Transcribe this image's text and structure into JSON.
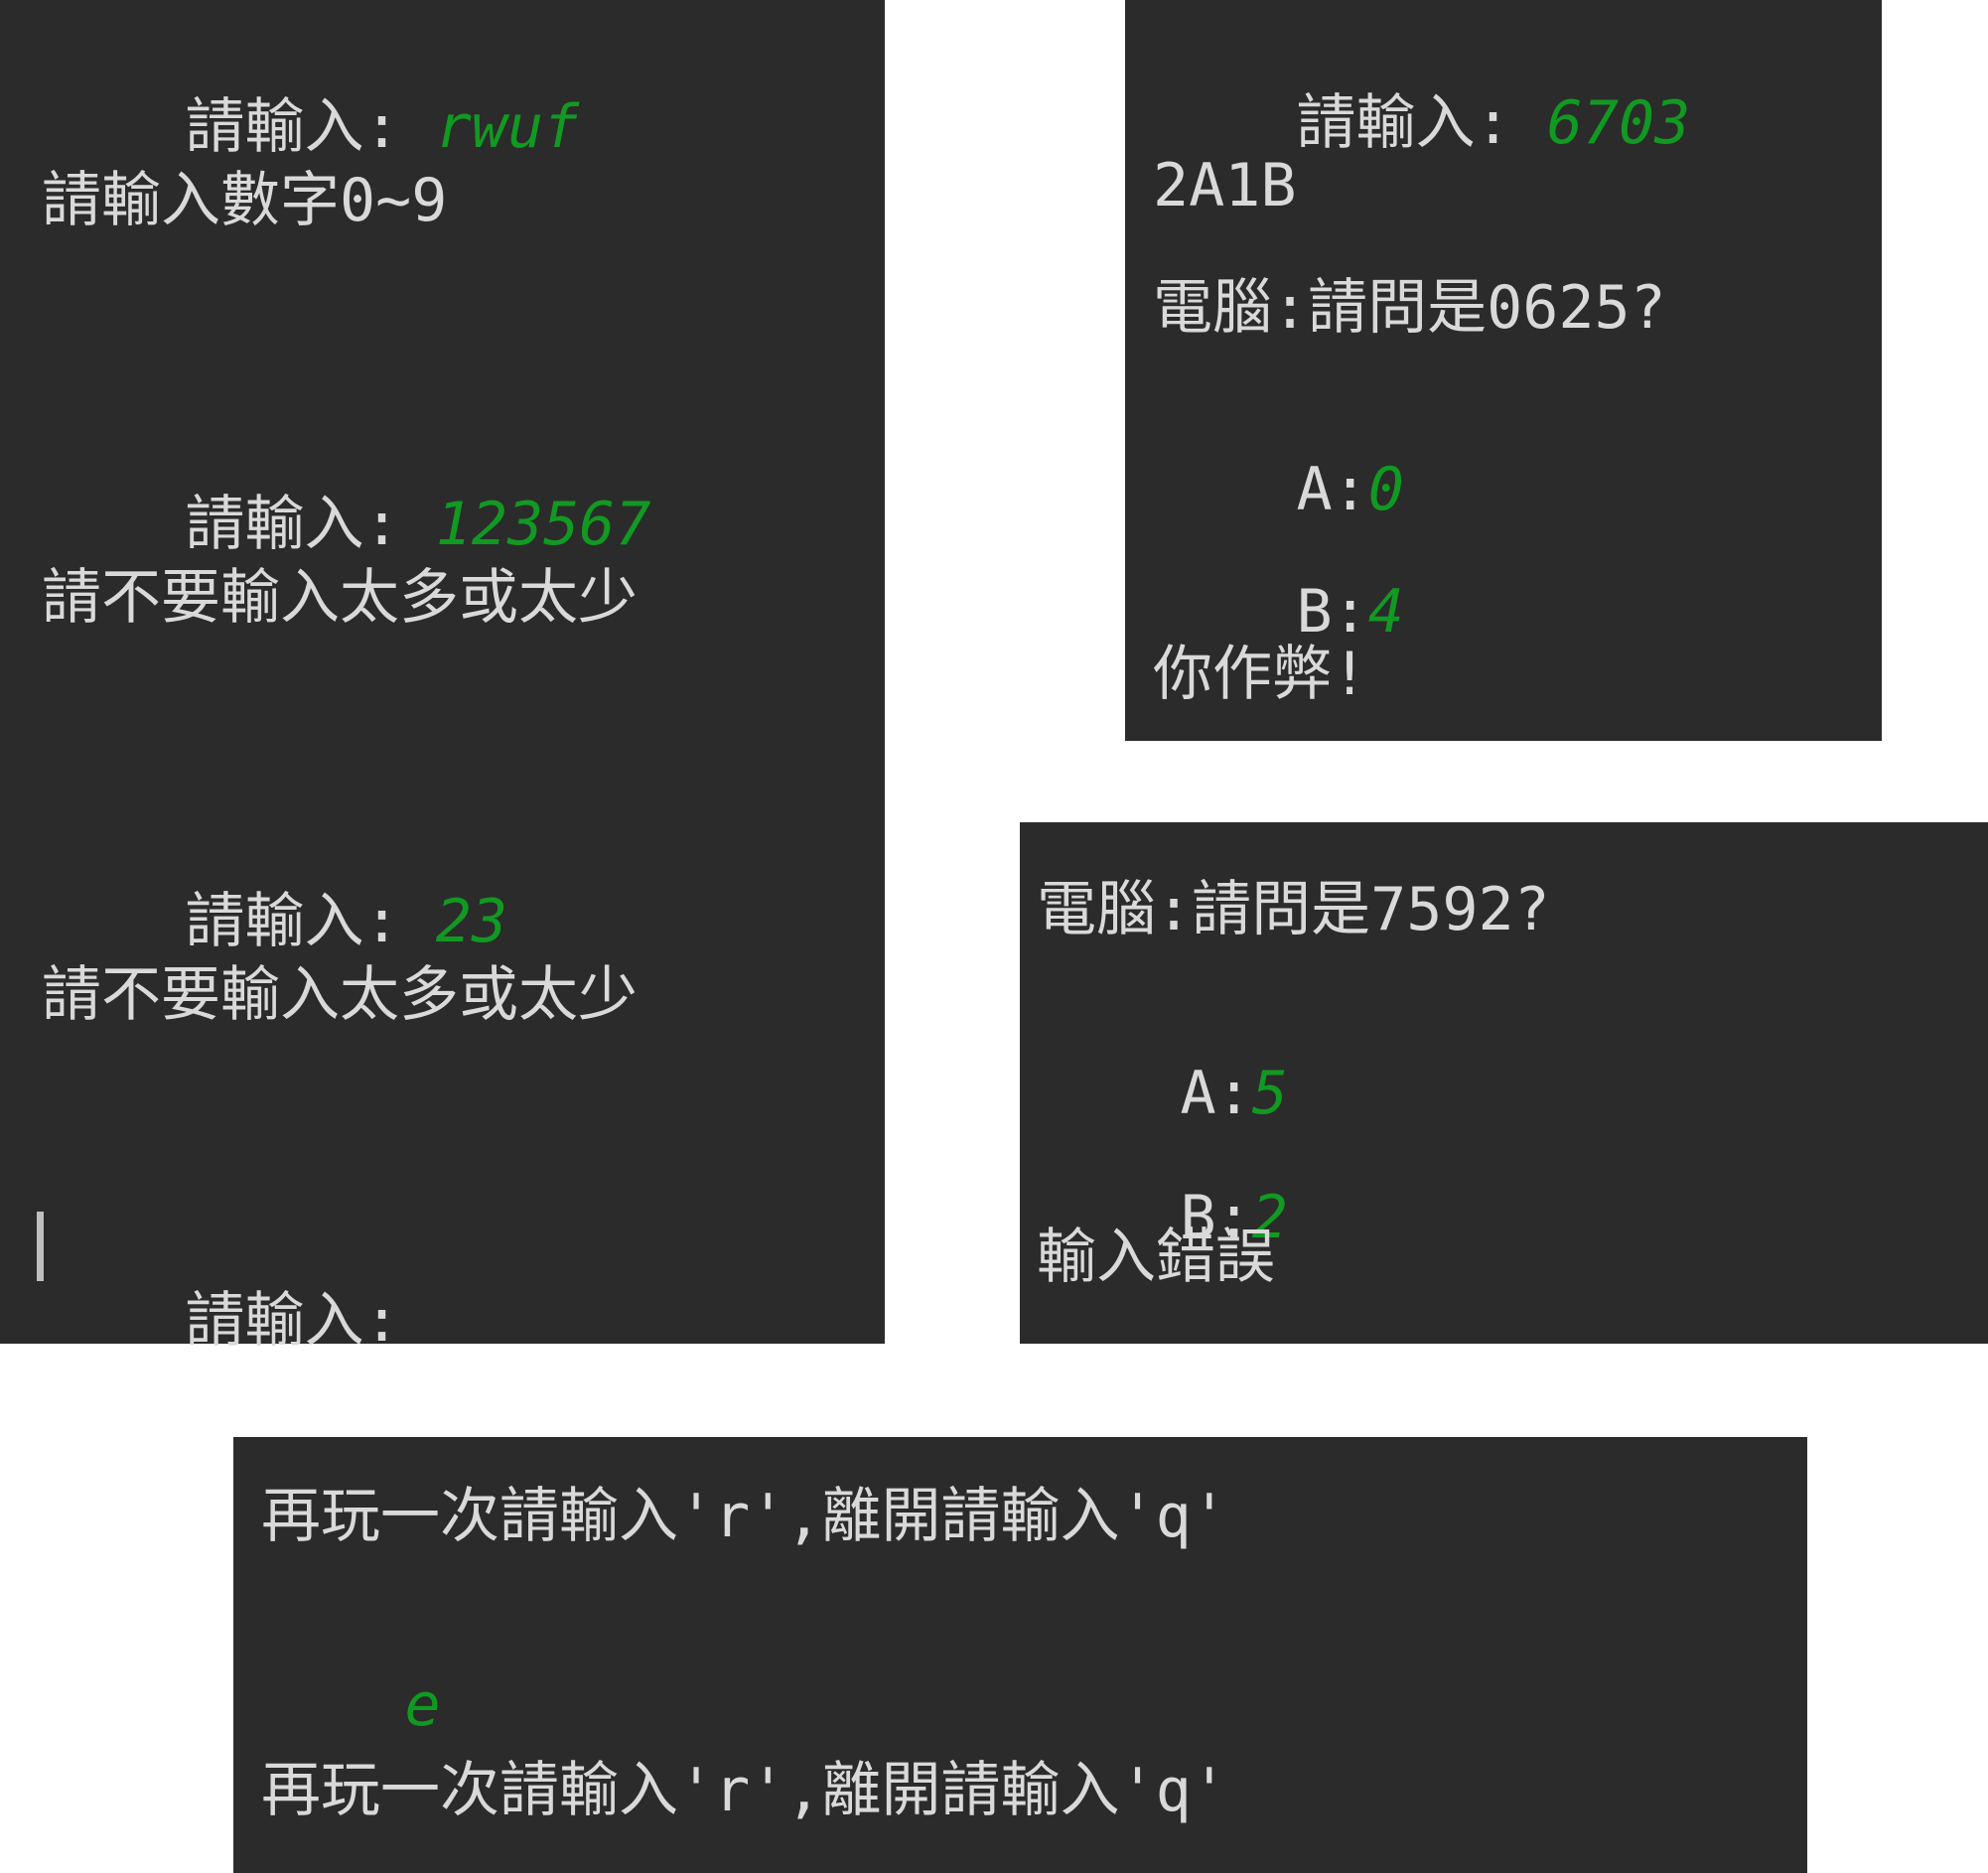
{
  "panel_a": {
    "prompt_label": "請輸入: ",
    "lines": [
      {
        "prompt": "請輸入: ",
        "input": "rwuf"
      },
      {
        "text": "請輸入數字0~9"
      },
      {
        "prompt": "請輸入: ",
        "input": "123567"
      },
      {
        "text": "請不要輸入太多或太少"
      },
      {
        "prompt": "請輸入: ",
        "input": "23"
      },
      {
        "text": "請不要輸入太多或太少"
      },
      {
        "prompt": "請輸入:"
      }
    ]
  },
  "panel_b": {
    "lines": [
      {
        "prompt": "請輸入: ",
        "input": "6703"
      },
      {
        "text": "2A1B"
      },
      {
        "text": "電腦:請問是0625?"
      },
      {
        "prompt": "A:",
        "input": "0"
      },
      {
        "prompt": "B:",
        "input": "4"
      },
      {
        "text": "你作弊!"
      }
    ]
  },
  "panel_c": {
    "lines": [
      {
        "text": "電腦:請問是7592?"
      },
      {
        "prompt": "A:",
        "input": "5"
      },
      {
        "prompt": "B:",
        "input": "2"
      },
      {
        "text": "輸入錯誤"
      }
    ]
  },
  "panel_d": {
    "lines": [
      {
        "text": "再玩一次請輸入'r',離開請輸入'q'"
      },
      {
        "input": "e"
      },
      {
        "text": "再玩一次請輸入'r',離開請輸入'q'"
      }
    ]
  },
  "colors": {
    "background": "#2b2b2b",
    "text": "#d9d9d9",
    "user_input": "#119922"
  }
}
